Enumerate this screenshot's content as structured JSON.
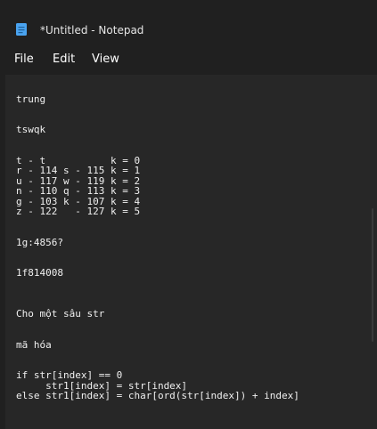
{
  "window": {
    "title": "*Untitled - Notepad",
    "icon": "notepad-icon"
  },
  "menu": {
    "file": "File",
    "edit": "Edit",
    "view": "View"
  },
  "editor": {
    "lines": [
      "",
      "trung",
      "",
      "",
      "tswqk",
      "",
      "",
      "t - t           k = 0",
      "r - 114 s - 115 k = 1",
      "u - 117 w - 119 k = 2",
      "n - 110 q - 113 k = 3",
      "g - 103 k - 107 k = 4",
      "z - 122   - 127 k = 5",
      "",
      "",
      "1g:4856?",
      "",
      "",
      "1f814008",
      "",
      "",
      "",
      "Cho một sâu str",
      "",
      "",
      "mã hóa",
      "",
      "",
      "if str[index] == 0",
      "     str1[index] = str[index]",
      "else str1[index] = char[ord(str[index]) + index]"
    ]
  },
  "colors": {
    "background": "#202020",
    "editor_background": "#272727",
    "text": "#f0f0f0",
    "icon_blue": "#4aa3f0"
  }
}
